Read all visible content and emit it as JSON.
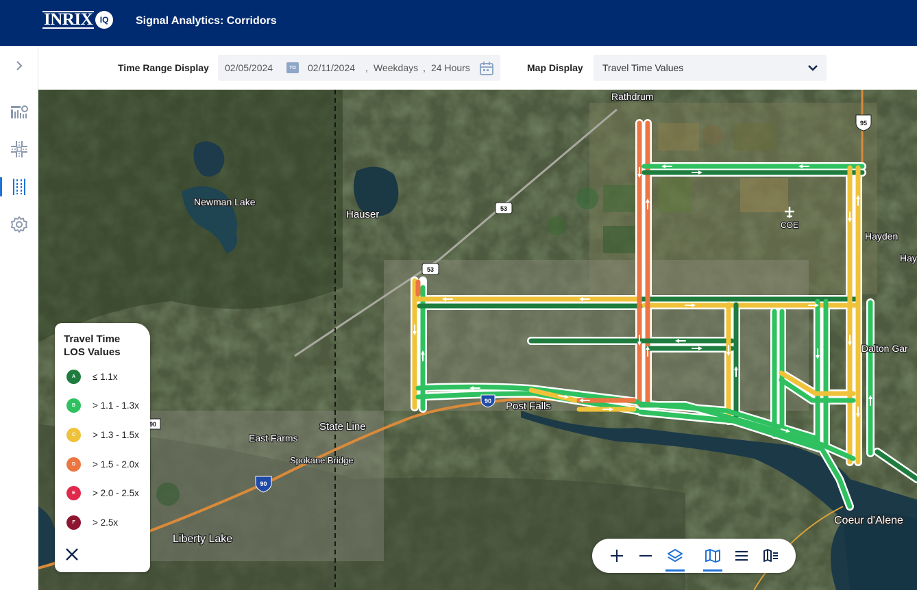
{
  "header": {
    "logo_text": "INRIX",
    "logo_badge": "IQ",
    "title": "Signal Analytics: Corridors"
  },
  "sidebar": {
    "items": [
      {
        "name": "expand",
        "icon": "chevron-right-icon"
      },
      {
        "name": "reports",
        "icon": "report-icon"
      },
      {
        "name": "intersections",
        "icon": "intersection-icon"
      },
      {
        "name": "corridors",
        "icon": "corridor-icon",
        "active": true
      },
      {
        "name": "settings",
        "icon": "gear-icon"
      }
    ]
  },
  "toolbar": {
    "time_range_label": "Time Range Display",
    "start_date": "02/05/2024",
    "to_badge": "TO",
    "end_date": "02/11/2024",
    "sep1": ",",
    "day_type": "Weekdays",
    "sep2": ",",
    "hours": "24 Hours",
    "map_display_label": "Map Display",
    "map_display_value": "Travel Time Values"
  },
  "map": {
    "places": {
      "rathdrum": "Rathdrum",
      "newman_lake": "Newman Lake",
      "hauser": "Hauser",
      "coe": "COE",
      "hayden": "Hayden",
      "hay": "Hay",
      "dalton": "Dalton Gar",
      "post_falls": "Post Falls",
      "state_line": "State Line",
      "east_farms": "East Farms",
      "spokane_bridge": "Spokane Bridge",
      "liberty_lake": "Liberty Lake",
      "coeur": "Coeur d'Alene"
    },
    "shields": {
      "s95": "95",
      "s53a": "53",
      "s53b": "53",
      "s90a": "90",
      "s90b": "90",
      "s90c": "90"
    }
  },
  "legend": {
    "title": "Travel Time LOS Values",
    "items": [
      {
        "grade": "A",
        "label": "≤ 1.1x",
        "color": "#1e7d3e"
      },
      {
        "grade": "B",
        "label": "> 1.1 - 1.3x",
        "color": "#2fc060"
      },
      {
        "grade": "C",
        "label": "> 1.3 - 1.5x",
        "color": "#f0c23a"
      },
      {
        "grade": "D",
        "label": "> 1.5 - 2.0x",
        "color": "#ec7642"
      },
      {
        "grade": "E",
        "label": "> 2.0 - 2.5x",
        "color": "#e0294b"
      },
      {
        "grade": "F",
        "label": "> 2.5x",
        "color": "#8e1630"
      }
    ]
  },
  "colors": {
    "header_bg": "#012b70",
    "accent": "#1f73d6",
    "los_a": "#1e7d3e",
    "los_b": "#2fc060",
    "los_c": "#f0c23a",
    "los_d": "#ec7642"
  }
}
